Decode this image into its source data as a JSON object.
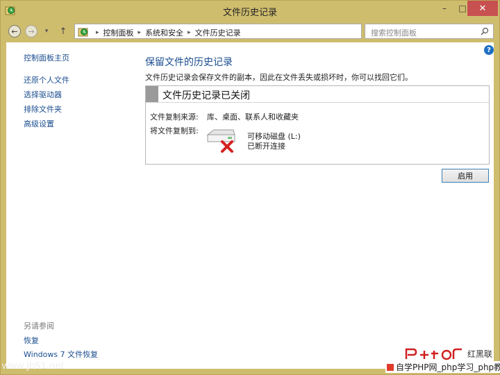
{
  "window": {
    "title": "文件历史记录",
    "minimize_glyph": "–",
    "maximize_glyph": "□",
    "close_glyph": "✕"
  },
  "nav": {
    "back_glyph": "←",
    "forward_glyph": "→",
    "recent_glyph": "▾",
    "up_glyph": "↑",
    "breadcrumbs": [
      "控制面板",
      "系统和安全",
      "文件历史记录"
    ],
    "breadcrumb_sep": "▸",
    "dropdown_glyph": "▾",
    "refresh_glyph": "↻",
    "search_placeholder": "搜索控制面板"
  },
  "help_glyph": "?",
  "sidebar": {
    "home": "控制面板主页",
    "links": [
      "还原个人文件",
      "选择驱动器",
      "排除文件夹",
      "高级设置"
    ],
    "see_also_label": "另请参阅",
    "see_also_links": [
      "恢复",
      "Windows 7 文件恢复"
    ]
  },
  "main": {
    "heading": "保留文件的历史记录",
    "description": "文件历史记录会保存文件的副本，因此在文件丢失或损坏时，你可以找回它们。",
    "status_title": "文件历史记录已关闭",
    "source_label": "文件复制来源:",
    "source_value": "库、桌面、联系人和收藏夹",
    "dest_label": "将文件复制到:",
    "drive_name": "可移动磁盘 (L:)",
    "drive_status": "已断开连接",
    "enable_button": "启用"
  },
  "watermarks": {
    "left": "www.jb51.net",
    "brand": "红黑联盟",
    "bottom": "自学PHP网_php学习_php教程"
  },
  "colors": {
    "window_frame": "#cfbd6e",
    "link": "#1a4d8f",
    "close_button": "#c75050",
    "error_red": "#d42020"
  },
  "icons": {
    "app": "file-history-icon",
    "drive": "removable-drive-icon",
    "status": "disconnected-x-icon"
  }
}
